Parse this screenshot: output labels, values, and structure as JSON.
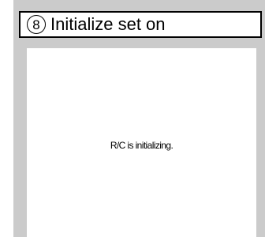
{
  "header": {
    "step_number": "8",
    "title": "Initialize set on"
  },
  "screen": {
    "message": "R/C is initializing."
  }
}
